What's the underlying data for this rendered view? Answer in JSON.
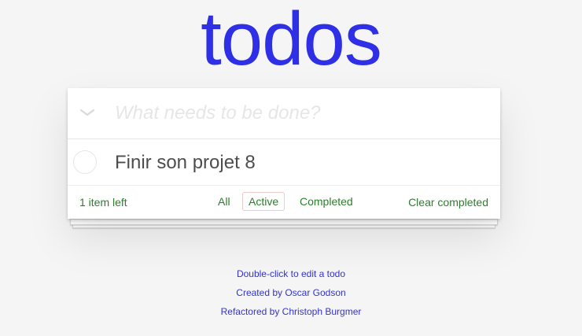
{
  "app": {
    "title": "todos"
  },
  "new_todo": {
    "placeholder": "What needs to be done?"
  },
  "todos": [
    {
      "label": "Finir son projet 8",
      "completed": false
    }
  ],
  "footer": {
    "count_text": "1 item left",
    "filters": [
      {
        "label": "All",
        "selected": false
      },
      {
        "label": "Active",
        "selected": true
      },
      {
        "label": "Completed",
        "selected": false
      }
    ],
    "clear_label": "Clear completed"
  },
  "info": {
    "line1": "Double-click to edit a todo",
    "line2": "Created by Oscar Godson",
    "line3": "Refactored by Christoph Burgmer"
  },
  "colors": {
    "title": "#2f2fe6",
    "footer_text": "#2d7d2d",
    "info_text": "#3333cc",
    "background": "#f5f5f5"
  },
  "icons": {
    "toggle_all": "chevron-down-icon"
  }
}
